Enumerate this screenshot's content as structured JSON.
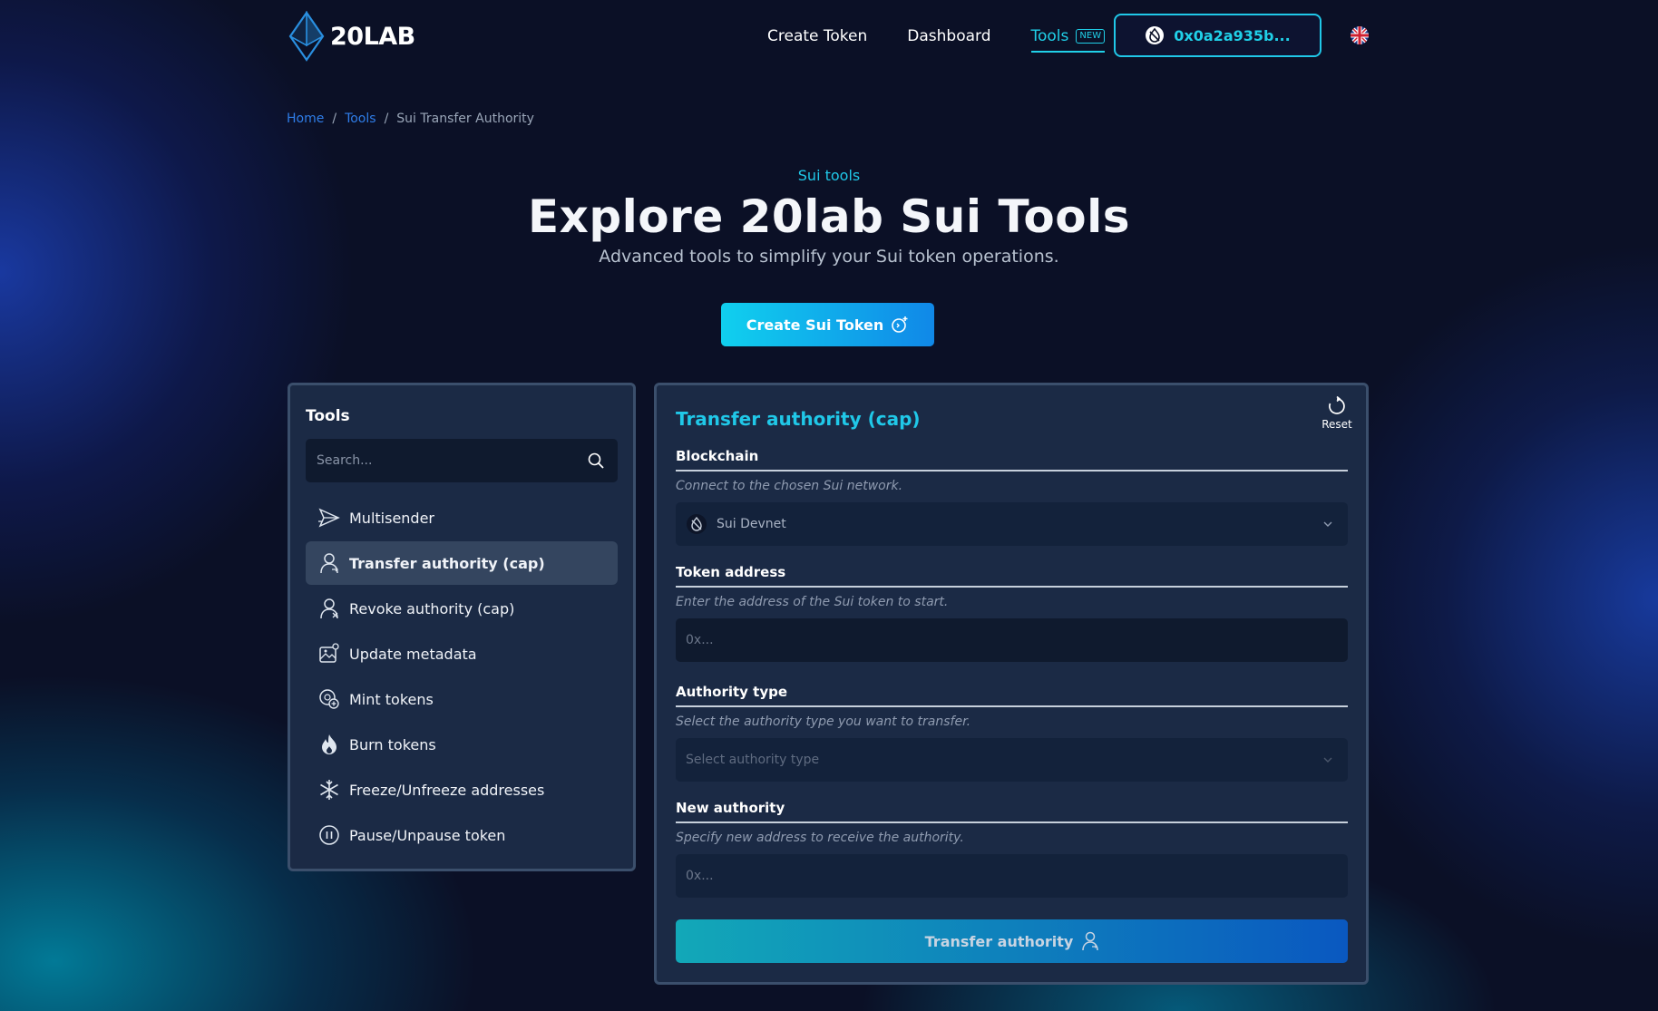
{
  "brand": {
    "logo_text": "20LAB"
  },
  "nav": {
    "create_token": "Create Token",
    "dashboard": "Dashboard",
    "tools": "Tools",
    "tools_badge": "NEW",
    "wallet_address": "0x0a2a935b..."
  },
  "breadcrumb": {
    "home": "Home",
    "sep1": "/",
    "tools": "Tools",
    "sep2": "/",
    "current": "Sui Transfer Authority"
  },
  "hero": {
    "eyebrow": "Sui tools",
    "title": "Explore 20lab Sui Tools",
    "subtitle": "Advanced tools to simplify your Sui token operations.",
    "cta": "Create Sui Token"
  },
  "sidebar": {
    "title": "Tools",
    "search_placeholder": "Search...",
    "items": [
      {
        "label": "Multisender",
        "icon": "send-icon"
      },
      {
        "label": "Transfer authority (cap)",
        "icon": "user-transfer-icon",
        "active": true
      },
      {
        "label": "Revoke authority (cap)",
        "icon": "user-revoke-icon"
      },
      {
        "label": "Update metadata",
        "icon": "image-edit-icon"
      },
      {
        "label": "Mint tokens",
        "icon": "coin-plus-icon"
      },
      {
        "label": "Burn tokens",
        "icon": "flame-icon"
      },
      {
        "label": "Freeze/Unfreeze addresses",
        "icon": "snowflake-icon"
      },
      {
        "label": "Pause/Unpause token",
        "icon": "pause-icon"
      }
    ]
  },
  "form": {
    "title": "Transfer authority (cap)",
    "reset_label": "Reset",
    "blockchain": {
      "label": "Blockchain",
      "help": "Connect to the chosen Sui network.",
      "value": "Sui Devnet"
    },
    "token_address": {
      "label": "Token address",
      "help": "Enter the address of the Sui token to start.",
      "placeholder": "0x..."
    },
    "authority_type": {
      "label": "Authority type",
      "help": "Select the authority type you want to transfer.",
      "placeholder": "Select authority type"
    },
    "new_authority": {
      "label": "New authority",
      "help": "Specify new address to receive the authority.",
      "placeholder": "0x..."
    },
    "submit_label": "Transfer authority"
  },
  "colors": {
    "accent": "#20c8e8",
    "link": "#2f7de8",
    "panel": "#1b2a45",
    "background": "#0b1026"
  }
}
